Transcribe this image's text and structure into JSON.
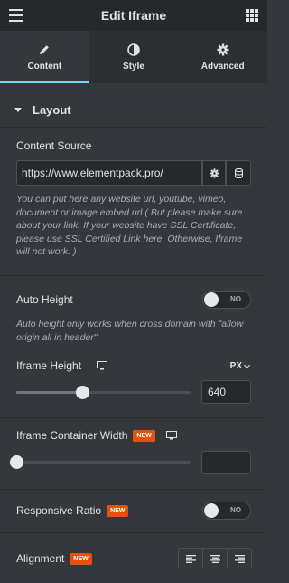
{
  "header": {
    "title": "Edit Iframe",
    "menu_icon": "hamburger-icon",
    "apps_icon": "grid-icon"
  },
  "tabs": [
    {
      "label": "Content",
      "icon": "pencil-icon",
      "active": true
    },
    {
      "label": "Style",
      "icon": "contrast-icon",
      "active": false
    },
    {
      "label": "Advanced",
      "icon": "gear-icon",
      "active": false
    }
  ],
  "section": {
    "label": "Layout"
  },
  "content_source": {
    "label": "Content Source",
    "value": "https://www.elementpack.pro/",
    "description": "You can put here any website url, youtube, vimeo, document or image embed url.( But please make sure about your link. If your website have SSL Certificate, please use SSL Certified Link here. Otherwise, Iframe will not work. )"
  },
  "auto_height": {
    "label": "Auto Height",
    "toggle_text": "NO",
    "checked": false,
    "description": "Auto height only works when cross domain with \"allow origin all in header\"."
  },
  "iframe_height": {
    "label": "Iframe Height",
    "unit": "PX",
    "value": "640",
    "slider_fraction": 0.38
  },
  "container_width": {
    "label": "Iframe Container Width",
    "badge": "NEW",
    "value": "",
    "slider_fraction": 0
  },
  "responsive_ratio": {
    "label": "Responsive Ratio",
    "badge": "NEW",
    "toggle_text": "NO",
    "checked": false
  },
  "alignment": {
    "label": "Alignment",
    "badge": "NEW",
    "options": [
      "left",
      "center",
      "right"
    ]
  },
  "colors": {
    "accent": "#71d7f7",
    "badge": "#e2510e",
    "panel": "#34383c",
    "header": "#26292c"
  }
}
